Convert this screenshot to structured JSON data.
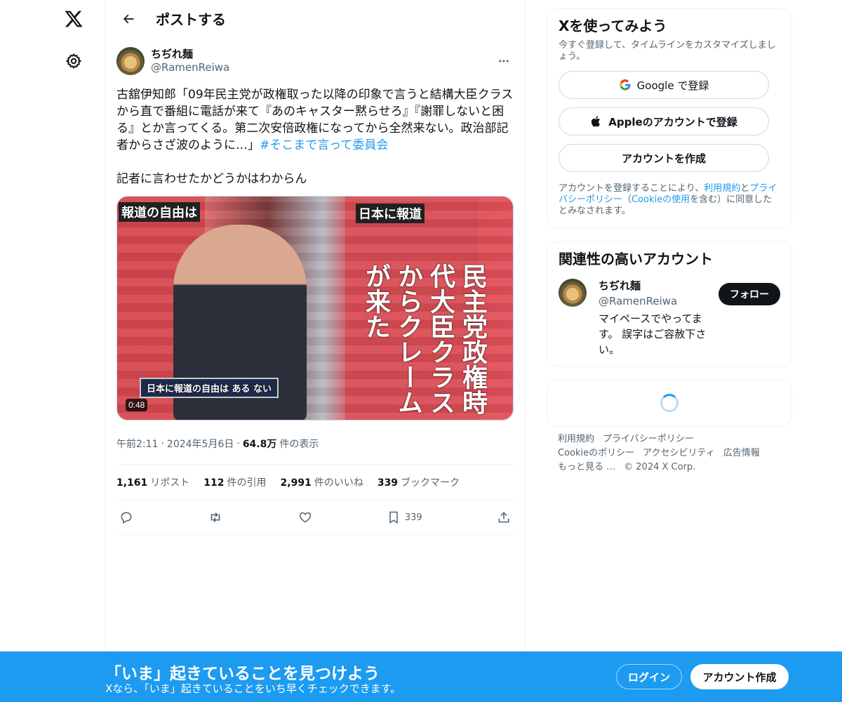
{
  "header": {
    "title": "ポストする"
  },
  "tweet": {
    "author_name": "ちぢれ麺",
    "author_handle": "@RamenReiwa",
    "text_main": "古舘伊知郎「09年民主党が政権取った以降の印象で言うと結構大臣クラスから直で番組に電話が来て『あのキャスター黙らせろ』『謝罪しないと困る』とか言ってくる。第二次安倍政権になってから全然来ない。政治部記者からさざ波のように…」",
    "hashtag": "#そこまで言って委員会",
    "text_tail": "記者に言わせたかどうかはわからん",
    "media": {
      "duration": "0:48",
      "caption_left_top": "報道の自由は",
      "caption_right_top": "日本に報道",
      "caption_right_vertical": "民主党政権時代大臣クラスからクレームが来た",
      "caption_bottom": "日本に報道の自由は ある ない"
    },
    "time": "午前2:11",
    "date": "2024年5月6日",
    "views_number": "64.8万",
    "views_label": "件の表示",
    "stats": {
      "reposts_num": "1,161",
      "reposts_label": "リポスト",
      "quotes_num": "112",
      "quotes_label": "件の引用",
      "likes_num": "2,991",
      "likes_label": "件のいいね",
      "bookmarks_num": "339",
      "bookmarks_label": "ブックマーク"
    },
    "bookmark_count": "339"
  },
  "signup_card": {
    "title": "Xを使ってみよう",
    "subtitle": "今すぐ登録して、タイムラインをカスタマイズしましょう。",
    "google_label": "Google で登録",
    "apple_label": "Appleのアカウントで登録",
    "create_label": "アカウントを作成",
    "legal_prefix": "アカウントを登録することにより、",
    "legal_terms": "利用規約",
    "legal_and": "と",
    "legal_privacy": "プライバシーポリシー",
    "legal_paren_open": "（",
    "legal_cookie": "Cookieの使用",
    "legal_suffix": "を含む）に同意したとみなされます。"
  },
  "relevant_card": {
    "title": "関連性の高いアカウント",
    "name": "ちぢれ麺",
    "handle": "@RamenReiwa",
    "bio": "マイペースでやってます。 誤字はご容赦下さい。",
    "follow_label": "フォロー"
  },
  "footer": {
    "links": [
      "利用規約",
      "プライバシーポリシー",
      "Cookieのポリシー",
      "アクセシビリティ",
      "広告情報",
      "もっと見る …"
    ],
    "copyright": "© 2024 X Corp."
  },
  "bottom_bar": {
    "title": "「いま」起きていることを見つけよう",
    "subtitle": "Xなら、「いま」起きていることをいち早くチェックできます。",
    "login_label": "ログイン",
    "signup_label": "アカウント作成"
  },
  "colors": {
    "accent": "#1d9bf0",
    "text": "#0f1419",
    "muted": "#536471"
  }
}
